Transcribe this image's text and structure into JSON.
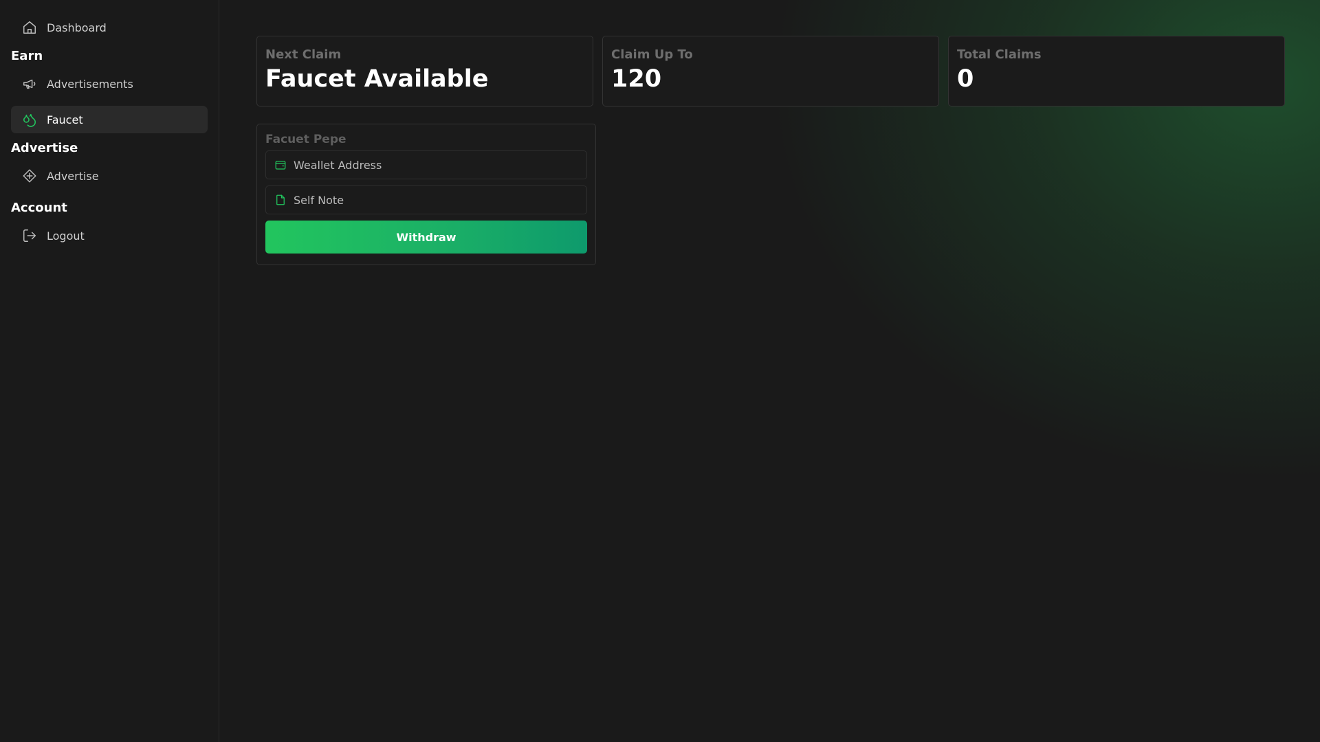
{
  "sidebar": {
    "dashboard_label": "Dashboard",
    "sections": {
      "earn": "Earn",
      "advertise": "Advertise",
      "account": "Account"
    },
    "items": {
      "advertisements": "Advertisements",
      "faucet": "Faucet",
      "advertise": "Advertise",
      "logout": "Logout"
    },
    "active_item": "Faucet"
  },
  "stats": [
    {
      "label": "Next Claim",
      "value": "Faucet Available"
    },
    {
      "label": "Claim Up To",
      "value": "120"
    },
    {
      "label": "Total Claims",
      "value": "0"
    }
  ],
  "form": {
    "title": "Facuet Pepe",
    "wallet_placeholder": "Weallet Address",
    "note_placeholder": "Self Note",
    "withdraw_label": "Withdraw"
  },
  "colors": {
    "background": "#1a1a1a",
    "accent": "#22c55e",
    "accent_dark": "#0e9a6c"
  },
  "icons": {
    "dashboard": "home-icon",
    "advertisements": "megaphone-icon",
    "faucet": "droplets-icon",
    "advertise": "diamond-plus-icon",
    "logout": "logout-icon",
    "wallet": "wallet-icon",
    "note": "file-icon"
  }
}
